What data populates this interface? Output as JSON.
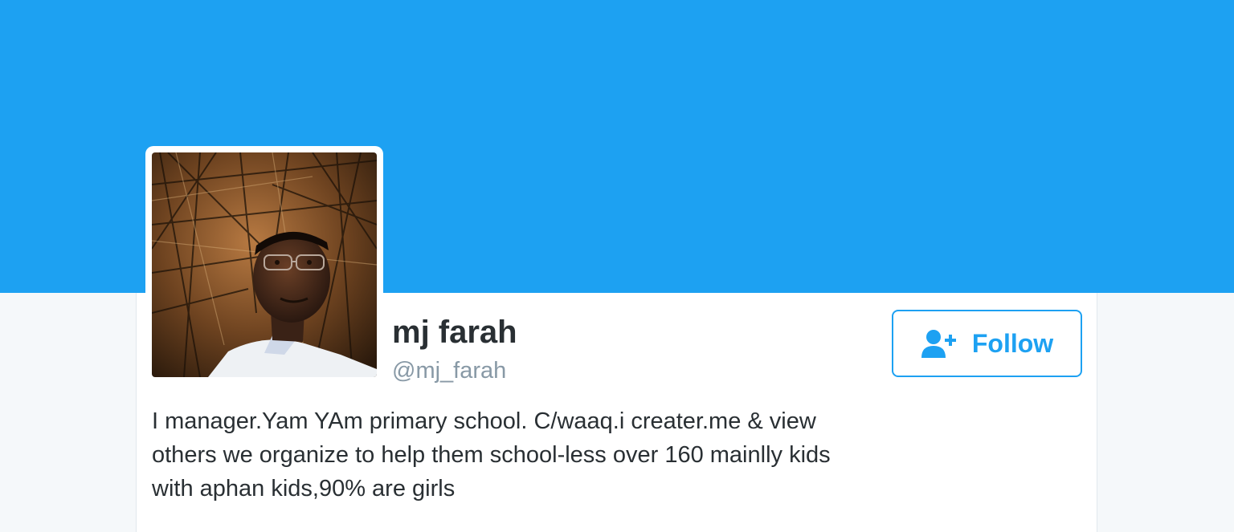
{
  "profile": {
    "display_name": "mj farah",
    "handle": "@mj_farah",
    "bio": "I manager.Yam YAm primary school. C/waaq.i creater.me & view others we organize to help them school-less over 160 mainlly kids with aphan kids,90% are girls"
  },
  "actions": {
    "follow_label": "Follow",
    "follow_icon": "add-user-icon"
  },
  "colors": {
    "banner": "#1da1f2",
    "accent": "#1da1f2",
    "text_primary": "#292f33",
    "text_secondary": "#8899a6",
    "page_background": "#f5f8fa"
  }
}
